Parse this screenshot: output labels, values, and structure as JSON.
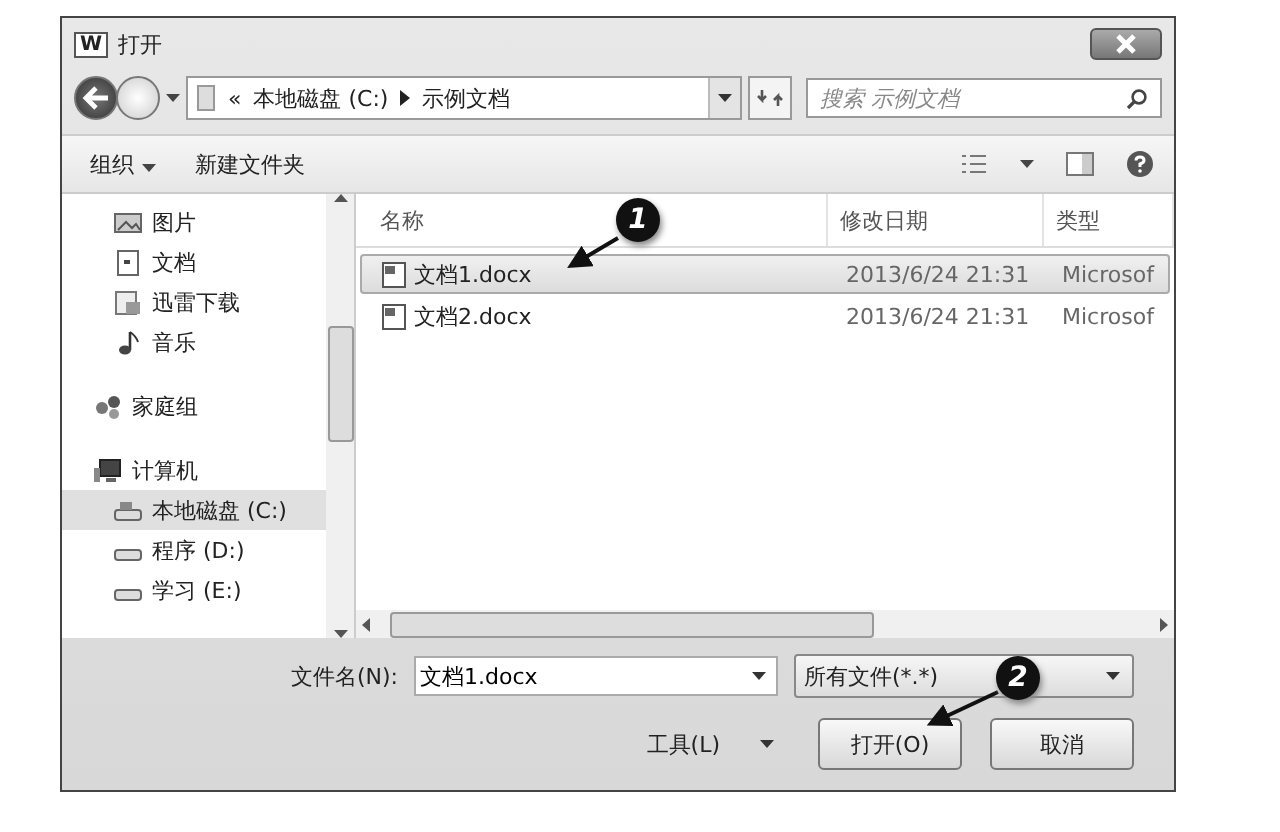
{
  "window": {
    "app_icon": "W",
    "title": "打开"
  },
  "address": {
    "overflow": "«",
    "crumbs": [
      "本地磁盘 (C:)",
      "示例文档"
    ]
  },
  "search": {
    "placeholder": "搜索 示例文档"
  },
  "toolbar": {
    "organize": "组织",
    "new_folder": "新建文件夹"
  },
  "sidebar": {
    "items": [
      {
        "label": "图片",
        "kind": "picture",
        "selected": false
      },
      {
        "label": "文档",
        "kind": "doc",
        "selected": false
      },
      {
        "label": "迅雷下载",
        "kind": "download",
        "selected": false
      },
      {
        "label": "音乐",
        "kind": "music",
        "selected": false
      },
      {
        "label": "家庭组",
        "kind": "homegroup",
        "selected": false
      },
      {
        "label": "计算机",
        "kind": "computer",
        "selected": false
      },
      {
        "label": "本地磁盘 (C:)",
        "kind": "drive",
        "selected": true
      },
      {
        "label": "程序 (D:)",
        "kind": "drive",
        "selected": false
      },
      {
        "label": "学习 (E:)",
        "kind": "drive",
        "selected": false
      }
    ]
  },
  "table": {
    "columns": [
      "名称",
      "修改日期",
      "类型"
    ],
    "rows": [
      {
        "name": "文档1.docx",
        "modified": "2013/6/24 21:31",
        "type": "Microsof",
        "selected": true
      },
      {
        "name": "文档2.docx",
        "modified": "2013/6/24 21:31",
        "type": "Microsof",
        "selected": false
      }
    ]
  },
  "filename": {
    "label": "文件名(N):",
    "value": "文档1.docx"
  },
  "filter": {
    "value": "所有文件(*.*)"
  },
  "tools": {
    "label": "工具(L)"
  },
  "buttons": [
    "打开(O)",
    "取消"
  ],
  "annotations": [
    "1",
    "2"
  ]
}
